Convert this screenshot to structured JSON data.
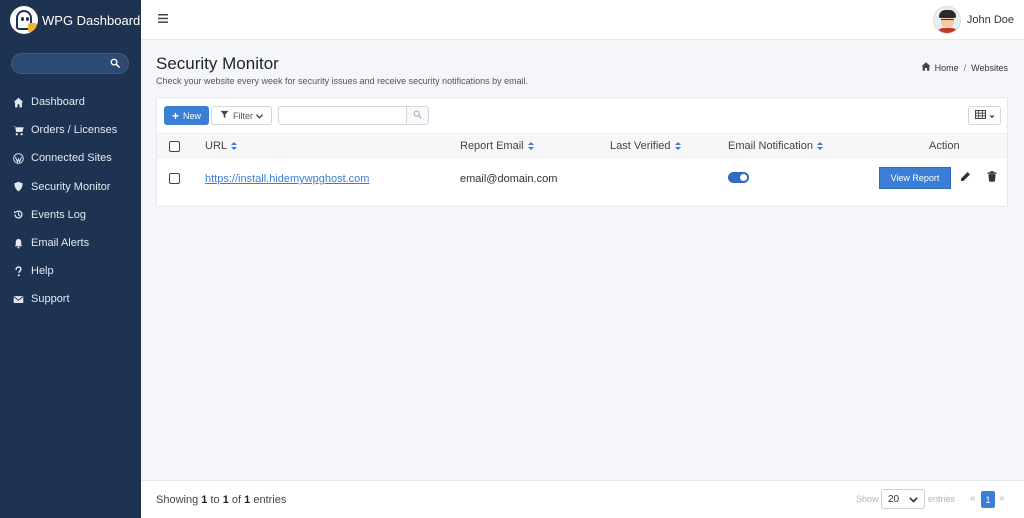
{
  "app": {
    "brand_title": "WPG Dashboard"
  },
  "sidebar": {
    "items": [
      {
        "label": "Dashboard",
        "icon": "home-icon"
      },
      {
        "label": "Orders / Licenses",
        "icon": "cart-icon"
      },
      {
        "label": "Connected Sites",
        "icon": "wordpress-icon"
      },
      {
        "label": "Security Monitor",
        "icon": "shield-icon"
      },
      {
        "label": "Events Log",
        "icon": "history-icon"
      },
      {
        "label": "Email Alerts",
        "icon": "bell-icon"
      },
      {
        "label": "Help",
        "icon": "question-icon"
      },
      {
        "label": "Support",
        "icon": "envelope-icon"
      }
    ]
  },
  "topbar": {
    "user_name": "John Doe"
  },
  "page": {
    "title": "Security Monitor",
    "subtitle": "Check your website every week for security issues and receive security notifications by email.",
    "breadcrumb": {
      "home": "Home",
      "current": "Websites"
    }
  },
  "toolbar": {
    "new_label": "New",
    "filter_label": "Filter",
    "search_value": ""
  },
  "table": {
    "columns": [
      "URL",
      "Report Email",
      "Last Verified",
      "Email Notification",
      "Action"
    ],
    "rows": [
      {
        "url": "https://install.hidemywpghost.com",
        "report_email": "email@domain.com",
        "last_verified": "",
        "email_notification": true,
        "action_label": "View Report"
      }
    ]
  },
  "footer": {
    "showing_prefix": "Showing",
    "from": "1",
    "to_word": "to",
    "to": "1",
    "of_word": "of",
    "total": "1",
    "entries_word": "entries",
    "show_label": "Show",
    "page_size": "20",
    "entries_label": "entries",
    "prev": "«",
    "current_page": "1",
    "next": "»"
  },
  "colors": {
    "sidebar_bg": "#1e3352",
    "accent": "#3a7fd5",
    "page_bg": "#f4f6f9"
  }
}
